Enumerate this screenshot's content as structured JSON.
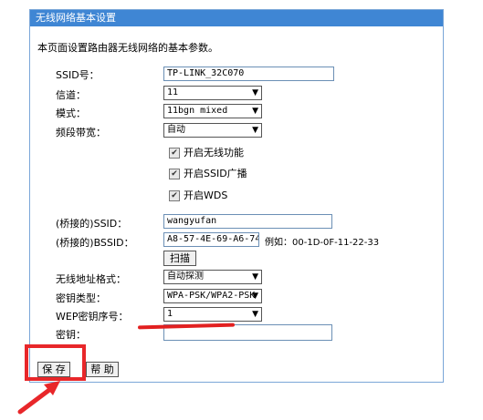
{
  "panel": {
    "title": "无线网络基本设置",
    "description": "本页面设置路由器无线网络的基本参数。"
  },
  "fields": {
    "ssid": {
      "label": "SSID号：",
      "value": "TP-LINK_32C070"
    },
    "channel": {
      "label": "信道：",
      "value": "11"
    },
    "mode": {
      "label": "模式：",
      "value": "11bgn mixed"
    },
    "bandwidth": {
      "label": "频段带宽：",
      "value": "自动"
    },
    "enable_wireless": {
      "label": "开启无线功能",
      "checked": true
    },
    "enable_ssid_broadcast": {
      "label": "开启SSID广播",
      "checked": true
    },
    "enable_wds": {
      "label": "开启WDS",
      "checked": true
    },
    "bridged_ssid": {
      "label": "(桥接的)SSID：",
      "value": "wangyufan"
    },
    "bridged_bssid": {
      "label": "(桥接的)BSSID：",
      "value": "A8-57-4E-69-A6-74",
      "example": "例如：00-1D-0F-11-22-33"
    },
    "scan_button": "扫描",
    "address_format": {
      "label": "无线地址格式：",
      "value": "自动探测"
    },
    "key_type": {
      "label": "密钥类型：",
      "value": "WPA-PSK/WPA2-PSK"
    },
    "wep_index": {
      "label": "WEP密钥序号：",
      "value": "1"
    },
    "key": {
      "label": "密钥：",
      "value": ""
    }
  },
  "buttons": {
    "save": "保 存",
    "help": "帮 助"
  },
  "icons": {
    "dropdown": "chevron-down-icon",
    "checkmark": "checkmark-icon"
  },
  "colors": {
    "title_bar": "#3f86d4",
    "annotation": "#e8272a"
  }
}
